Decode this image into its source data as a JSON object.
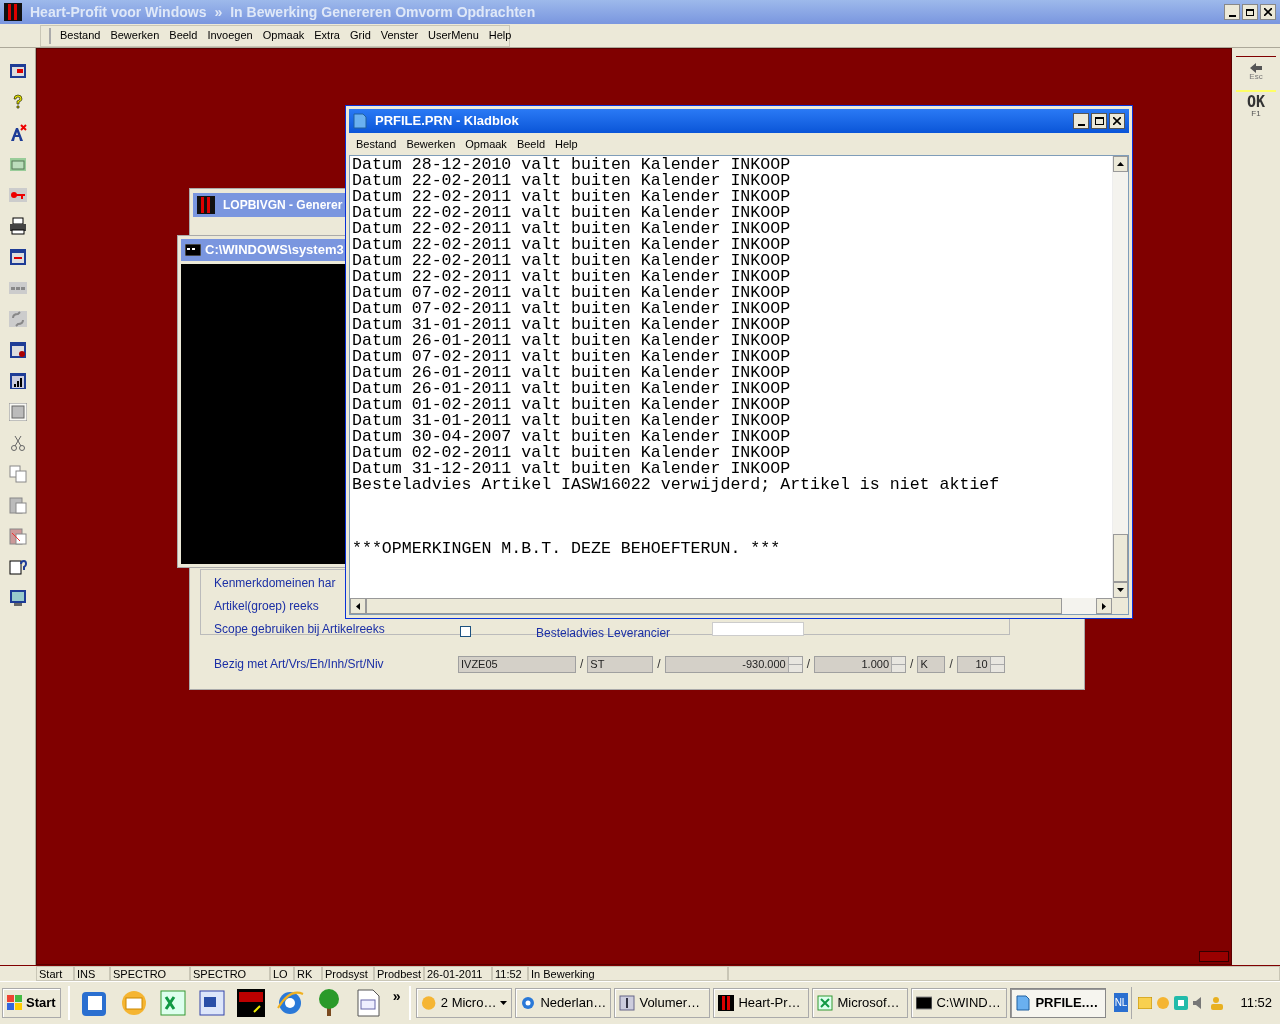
{
  "app_window": {
    "title": "Heart-Profit voor Windows",
    "separator": "»",
    "subtitle": "In Bewerking Genereren Omvorm Opdrachten"
  },
  "menu": [
    "Bestand",
    "Bewerken",
    "Beeld",
    "Invoegen",
    "Opmaak",
    "Extra",
    "Grid",
    "Venster",
    "UserMenu",
    "Help"
  ],
  "right_panel": [
    {
      "label": "Esc"
    },
    {
      "label": "OK",
      "key": "F1"
    }
  ],
  "dialog": {
    "title": "LOPBIVGN - Generer",
    "labels": [
      "Kenmerkdomeinen har",
      "Artikel(groep) reeks",
      "Scope gebruiken bij Artikelreeks"
    ],
    "scope_checkbox": {
      "checked": false
    },
    "side_label": "Besteladvies Leverancier",
    "progress": {
      "label": "Bezig met Art/Vrs/Eh/Inh/Srt/Niv",
      "separator": "/",
      "fields": [
        {
          "value": "IVZE05",
          "kind": "text"
        },
        {
          "value": "ST",
          "kind": "text"
        },
        {
          "value": "-930.000",
          "kind": "spin"
        },
        {
          "value": "1.000",
          "kind": "spin"
        },
        {
          "value": "K",
          "kind": "text"
        },
        {
          "value": "10",
          "kind": "spin"
        }
      ]
    }
  },
  "console": {
    "title": "C:\\WINDOWS\\system3"
  },
  "notepad": {
    "title": "PRFILE.PRN - Kladblok",
    "menu": [
      "Bestand",
      "Bewerken",
      "Opmaak",
      "Beeld",
      "Help"
    ],
    "lines": [
      "Datum 28-12-2010 valt buiten Kalender INKOOP",
      "Datum 22-02-2011 valt buiten Kalender INKOOP",
      "Datum 22-02-2011 valt buiten Kalender INKOOP",
      "Datum 22-02-2011 valt buiten Kalender INKOOP",
      "Datum 22-02-2011 valt buiten Kalender INKOOP",
      "Datum 22-02-2011 valt buiten Kalender INKOOP",
      "Datum 22-02-2011 valt buiten Kalender INKOOP",
      "Datum 22-02-2011 valt buiten Kalender INKOOP",
      "Datum 07-02-2011 valt buiten Kalender INKOOP",
      "Datum 07-02-2011 valt buiten Kalender INKOOP",
      "Datum 31-01-2011 valt buiten Kalender INKOOP",
      "Datum 26-01-2011 valt buiten Kalender INKOOP",
      "Datum 07-02-2011 valt buiten Kalender INKOOP",
      "Datum 26-01-2011 valt buiten Kalender INKOOP",
      "Datum 26-01-2011 valt buiten Kalender INKOOP",
      "Datum 01-02-2011 valt buiten Kalender INKOOP",
      "Datum 31-01-2011 valt buiten Kalender INKOOP",
      "Datum 30-04-2007 valt buiten Kalender INKOOP",
      "Datum 02-02-2011 valt buiten Kalender INKOOP",
      "Datum 31-12-2011 valt buiten Kalender INKOOP",
      "Besteladvies Artikel IASW16022 verwijderd; Artikel is niet aktief"
    ],
    "remark": "***OPMERKINGEN M.B.T. DEZE BEHOEFTERUN. ***"
  },
  "status_bar": [
    "Start",
    "INS",
    "SPECTRO",
    "SPECTRO",
    "LO",
    "RK",
    "Prodsyst",
    "Prodbest",
    "26-01-2011",
    "11:52",
    "In Bewerking"
  ],
  "taskbar": {
    "start": "Start",
    "more": "»",
    "tasks": [
      {
        "label": "2 Micro…",
        "grouped": true,
        "selected": false
      },
      {
        "label": "Nederlan…",
        "grouped": false,
        "selected": false
      },
      {
        "label": "Volumer…",
        "grouped": false,
        "selected": false
      },
      {
        "label": "Heart-Pr…",
        "grouped": false,
        "selected": false
      },
      {
        "label": "Microsof…",
        "grouped": false,
        "selected": false
      },
      {
        "label": "C:\\WIND…",
        "grouped": false,
        "selected": false
      },
      {
        "label": "PRFILE.…",
        "grouped": false,
        "selected": true
      }
    ],
    "language": "NL",
    "time": "11:52"
  }
}
